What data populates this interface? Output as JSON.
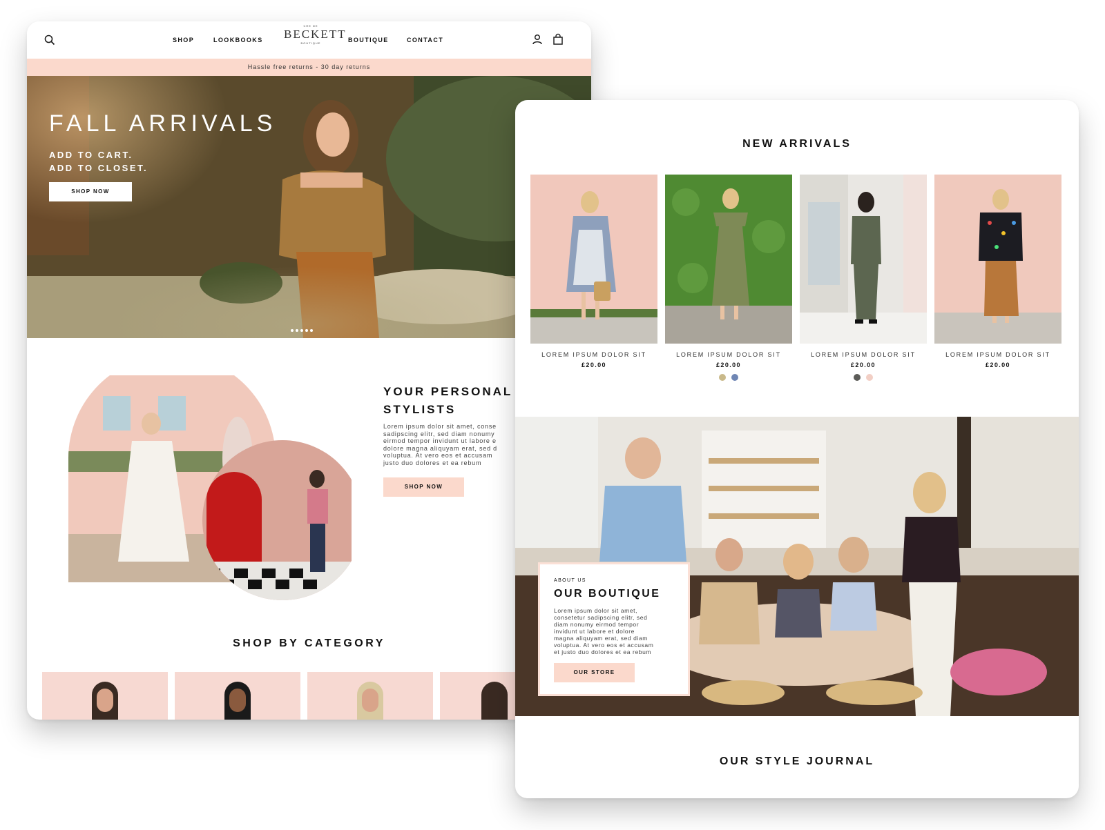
{
  "header": {
    "nav_left": [
      "SHOP",
      "LOOKBOOKS"
    ],
    "nav_right": [
      "BOUTIQUE",
      "CONTACT"
    ],
    "logo_small_top": "CHE DE",
    "logo_name": "BECKETT",
    "logo_small_bottom": "BOUTIQUE",
    "icons": [
      "search-icon",
      "user-icon",
      "bag-icon"
    ]
  },
  "announcement": "Hassle free returns - 30 day returns",
  "hero": {
    "title": "FALL ARRIVALS",
    "sub_line1": "ADD TO CART.",
    "sub_line2": "ADD TO CLOSET.",
    "cta": "SHOP NOW",
    "slide_count": 5
  },
  "stylists": {
    "title_line1": "YOUR PERSONAL",
    "title_line2": "STYLISTS",
    "body": [
      "Lorem ipsum dolor sit amet, conse",
      "sadipscing elitr, sed diam nonumy",
      "eirmod tempor invidunt ut labore e",
      "dolore magna aliquyam erat, sed d",
      "voluptua. At vero eos et accusam",
      "justo duo dolores et ea rebum"
    ],
    "cta": "SHOP NOW"
  },
  "shop_by_category": {
    "title": "SHOP BY CATEGORY"
  },
  "new_arrivals": {
    "title": "NEW ARRIVALS",
    "products": [
      {
        "name": "LOREM IPSUM DOLOR SIT",
        "price": "£20.00",
        "swatches": []
      },
      {
        "name": "LOREM IPSUM DOLOR SIT",
        "price": "£20.00",
        "swatches": [
          "#c9b98a",
          "#6f86b4"
        ]
      },
      {
        "name": "LOREM IPSUM DOLOR SIT",
        "price": "£20.00",
        "swatches": [
          "#5c5c58",
          "#f2cfc5"
        ]
      },
      {
        "name": "LOREM IPSUM DOLOR SIT",
        "price": "£20.00",
        "swatches": []
      }
    ]
  },
  "about": {
    "eyebrow": "ABOUT US",
    "title": "OUR BOUTIQUE",
    "body": [
      "Lorem ipsum dolor sit amet,",
      "consetetur sadipscing elitr, sed",
      "diam nonumy eirmod tempor",
      "invidunt ut labore et dolore",
      "magna aliquyam erat, sed diam",
      "voluptua. At vero eos et accusam",
      "et justo duo dolores et ea rebum"
    ],
    "cta": "OUR STORE"
  },
  "journal": {
    "title": "OUR STYLE JOURNAL"
  },
  "colors": {
    "accent_pink": "#fbd9cc",
    "text_dark": "#111111"
  }
}
